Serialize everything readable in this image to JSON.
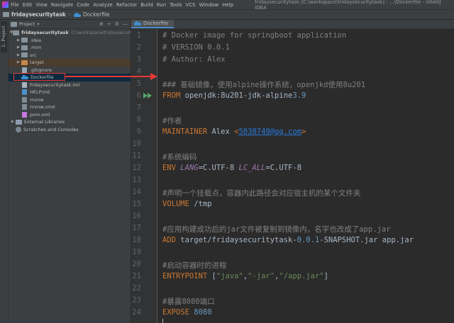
{
  "menu": {
    "items": [
      {
        "label": "File"
      },
      {
        "label": "Edit"
      },
      {
        "label": "View"
      },
      {
        "label": "Navigate"
      },
      {
        "label": "Code"
      },
      {
        "label": "Analyze"
      },
      {
        "label": "Refactor"
      },
      {
        "label": "Build"
      },
      {
        "label": "Run"
      },
      {
        "label": "Tools"
      },
      {
        "label": "VCS"
      },
      {
        "label": "Window"
      },
      {
        "label": "Help"
      }
    ],
    "window_title": "fridaysecuritytask [C:\\workspace\\fridaysecuritytask] - ...\\Dockerfile - IntelliJ IDEA"
  },
  "breadcrumb": {
    "project": "fridaysecuritytask",
    "file": "Dockerfile"
  },
  "left_strip": {
    "project_tab": "1: Project"
  },
  "project_panel": {
    "title": "Project",
    "tools": [
      "⊕",
      "÷",
      "⚙",
      "—"
    ],
    "root": {
      "name": "fridaysecuritytask",
      "path": "C:\\workspace\\fridaysecuritytask"
    },
    "items": [
      {
        "name": ".idea"
      },
      {
        "name": ".mvn"
      },
      {
        "name": "src"
      },
      {
        "name": "target"
      },
      {
        "name": ".gitignore"
      },
      {
        "name": "Dockerfile"
      },
      {
        "name": "fridaysecuritytask.iml"
      },
      {
        "name": "HELP.md"
      },
      {
        "name": "mvnw"
      },
      {
        "name": "mvnw.cmd"
      },
      {
        "name": "pom.xml"
      }
    ],
    "external": "External Libraries",
    "scratches": "Scratches and Consoles"
  },
  "editor": {
    "tab": "Dockerfile",
    "line_numbers": [
      "1",
      "2",
      "3",
      "4",
      "5",
      "6",
      "7",
      "8",
      "9",
      "10",
      "11",
      "12",
      "13",
      "14",
      "15",
      "16",
      "17",
      "18",
      "19",
      "20",
      "21",
      "22",
      "23",
      "24"
    ],
    "lines": {
      "l1": "# Docker image for springboot application",
      "l2": "# VERSION 0.0.1",
      "l3": "# Author: Alex",
      "l5": "### 基础镜像，使用alpine操作系统，openjkd使用8u201",
      "l6_kw": "FROM",
      "l6_a": " openjdk:8u201-jdk-alpine",
      "l6_b": "3.9",
      "l8": "#作者",
      "l9_kw": "MAINTAINER",
      "l9_a": " Alex ",
      "l9_b": "<",
      "l9_c": "5030749@qq.com",
      "l9_d": ">",
      "l11": "#系统编码",
      "l12_kw": "ENV",
      "l12_a": " ",
      "l12_v1": "LANG",
      "l12_b": "=C.UTF-8 ",
      "l12_v2": "LC_ALL",
      "l12_c": "=C.UTF-8",
      "l14": "#声明一个挂载点，容器内此路径会对应宿主机的某个文件夹",
      "l15_kw": "VOLUME",
      "l15_a": " /tmp",
      "l17": "#应用构建成功后的jar文件被复制到镜像内，名字也改成了app.jar",
      "l18_kw": "ADD",
      "l18_a": " target/fridaysecuritytask-",
      "l18_b": "0.0.1",
      "l18_c": "-SNAPSHOT.jar app.jar",
      "l20": "#启动容器时的进程",
      "l21_kw": "ENTRYPOINT",
      "l21_a": " [",
      "l21_s1": "\"java\"",
      "l21_b": ",",
      "l21_s2": "\"-jar\"",
      "l21_c": ",",
      "l21_s3": "\"/app.jar\"",
      "l21_d": "]",
      "l23": "#暴露8080端口",
      "l24_kw": "EXPOSE",
      "l24_a": " ",
      "l24_b": "8080"
    }
  },
  "colors": {
    "annotation": "#e53935",
    "keyword": "#cc7832",
    "comment": "#808080",
    "string": "#6a8759",
    "number": "#6897bb"
  }
}
